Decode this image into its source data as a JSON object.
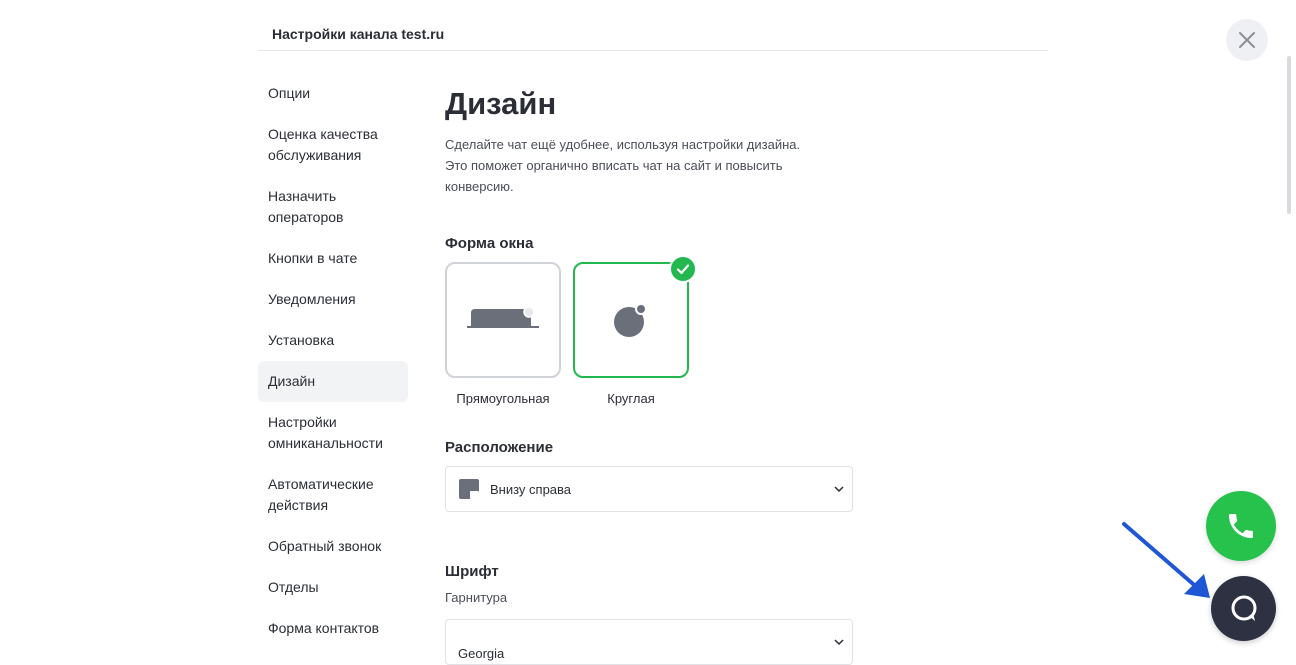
{
  "header": {
    "title": "Настройки канала test.ru"
  },
  "sidebar": {
    "items": [
      {
        "label": "Опции"
      },
      {
        "label": "Оценка качества обслуживания"
      },
      {
        "label": "Назначить операторов"
      },
      {
        "label": "Кнопки в чате"
      },
      {
        "label": "Уведомления"
      },
      {
        "label": "Установка"
      },
      {
        "label": "Дизайн",
        "active": true
      },
      {
        "label": "Настройки омниканальности"
      },
      {
        "label": "Автоматические действия"
      },
      {
        "label": "Обратный звонок"
      },
      {
        "label": "Отделы"
      },
      {
        "label": "Форма контактов"
      }
    ]
  },
  "main": {
    "title": "Дизайн",
    "description_lines": [
      "Сделайте чат ещё удобнее, используя настройки дизайна.",
      "Это поможет органично вписать чат на сайт и повысить",
      "конверсию."
    ],
    "window_shape": {
      "title": "Форма окна",
      "options": [
        {
          "label": "Прямоугольная",
          "selected": false
        },
        {
          "label": "Круглая",
          "selected": true
        }
      ]
    },
    "position": {
      "title": "Расположение",
      "value": "Внизу справа"
    },
    "font": {
      "title": "Шрифт",
      "typeface_label": "Гарнитура",
      "value": "Georgia"
    }
  },
  "colors": {
    "accent_green": "#22b84f",
    "chat_button": "#2d3142",
    "arrow": "#1f56d6"
  },
  "icons": [
    "close-icon",
    "check-icon",
    "chevron-down-icon",
    "phone-icon",
    "chat-icon",
    "arrow-icon"
  ]
}
